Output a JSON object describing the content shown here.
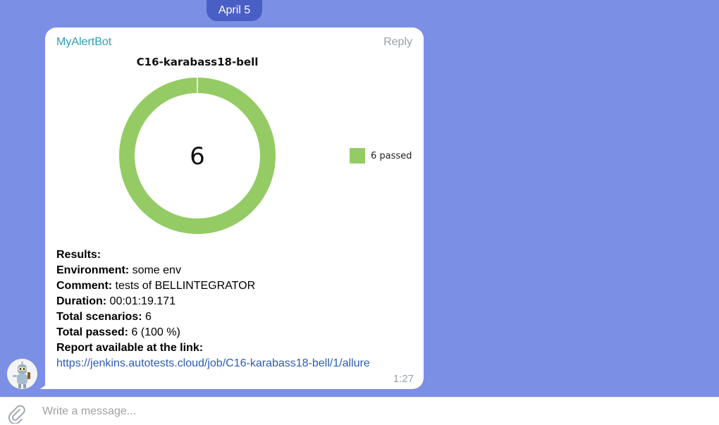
{
  "date_separator": "April 5",
  "message": {
    "sender": "MyAlertBot",
    "reply_label": "Reply",
    "time": "1:27",
    "results_heading": "Results:",
    "fields": [
      {
        "label": "Environment:",
        "value": " some env"
      },
      {
        "label": "Comment:",
        "value": " tests of BELLINTEGRATOR"
      },
      {
        "label": "Duration:",
        "value": " 00:01:19.171"
      },
      {
        "label": "Total scenarios:",
        "value": " 6"
      },
      {
        "label": "Total passed:",
        "value": " 6 (100 %)"
      }
    ],
    "report_label": "Report available at the link:",
    "report_link": "https://jenkins.autotests.cloud/job/C16-karabass18-bell/1/allure"
  },
  "chart_data": {
    "type": "pie",
    "title": "C16-karabass18-bell",
    "center_label": "6",
    "slices": [
      {
        "name": "passed",
        "value": 6,
        "color": "#94cb64"
      }
    ],
    "legend": [
      {
        "label": "6 passed",
        "color": "#94cb64"
      }
    ],
    "legend_position": "right"
  },
  "composer": {
    "placeholder": "Write a message..."
  },
  "colors": {
    "background": "#7b8fe4",
    "date_pill": "#4a5fc6",
    "sender": "#2e9db1",
    "link": "#2b5cb5",
    "passed": "#94cb64"
  },
  "icons": {
    "attach": "paperclip-icon",
    "avatar": "robot-avatar"
  }
}
